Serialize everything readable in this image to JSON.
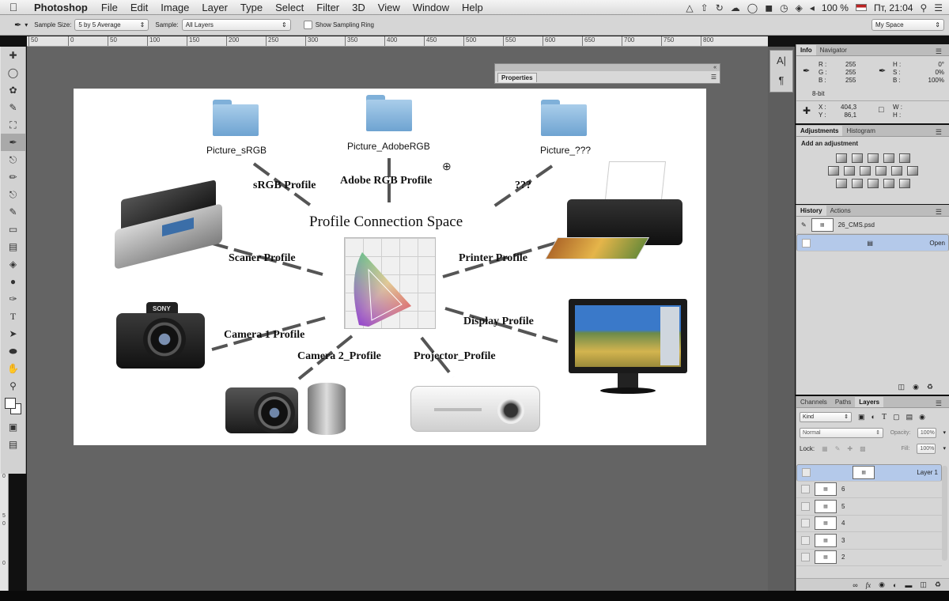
{
  "menubar": {
    "app_name": "Photoshop",
    "items": [
      "File",
      "Edit",
      "Image",
      "Layer",
      "Type",
      "Select",
      "Filter",
      "3D",
      "View",
      "Window",
      "Help"
    ],
    "battery": "100 %",
    "clock": "Пт, 21:04"
  },
  "options": {
    "sample_size_label": "Sample Size:",
    "sample_size_value": "5 by 5 Average",
    "sample_label": "Sample:",
    "sample_value": "All Layers",
    "ring_label": "Show Sampling Ring",
    "workspace": "My Space"
  },
  "ruler": {
    "top": [
      "50",
      "0",
      "50",
      "100",
      "150",
      "200",
      "250",
      "300",
      "350",
      "400",
      "450",
      "500",
      "550",
      "600",
      "650",
      "700",
      "750",
      "800"
    ],
    "left": [
      "0",
      "5",
      "0",
      "0"
    ]
  },
  "properties_panel": {
    "tab": "Properties"
  },
  "diagram": {
    "center_title": "Profile Connection Space",
    "folders": [
      "Picture_sRGB",
      "Picture_AdobeRGB",
      "Picture_???"
    ],
    "links": {
      "srgb": "sRGB Profile",
      "adobe": "Adobe RGB Profile",
      "unknown": "???",
      "scanner": "Scaner Profile",
      "printer": "Printer Profile",
      "display": "Display Profile",
      "camera1": "Camera 1 Profile",
      "camera2": "Camera 2_Profile",
      "projector": "Projector_Profile"
    },
    "camera_brand": "SONY"
  },
  "info_panel": {
    "tabs": [
      "Info",
      "Navigator"
    ],
    "rgb_labels": [
      "R :",
      "G :",
      "B :"
    ],
    "rgb_values": [
      "255",
      "255",
      "255"
    ],
    "hsb_labels": [
      "H :",
      "S :",
      "B :"
    ],
    "hsb_values": [
      "0°",
      "0%",
      "100%"
    ],
    "bit_depth": "8-bit",
    "x_label": "X :",
    "x_value": "404,3",
    "y_label": "Y :",
    "y_value": "86,1",
    "w_label": "W :",
    "h_label": "H :"
  },
  "adjustments_panel": {
    "tabs": [
      "Adjustments",
      "Histogram"
    ],
    "heading": "Add an adjustment"
  },
  "history_panel": {
    "tabs": [
      "History",
      "Actions"
    ],
    "snapshot": "26_CMS.psd",
    "items": [
      "Open"
    ]
  },
  "layers_panel": {
    "tabs": [
      "Channels",
      "Paths",
      "Layers"
    ],
    "filter": "Kind",
    "blend_mode": "Normal",
    "opacity_label": "Opacity:",
    "opacity_value": "100%",
    "lock_label": "Lock:",
    "fill_label": "Fill:",
    "fill_value": "100%",
    "layers": [
      "Layer 1",
      "6",
      "5",
      "4",
      "3",
      "2"
    ]
  }
}
